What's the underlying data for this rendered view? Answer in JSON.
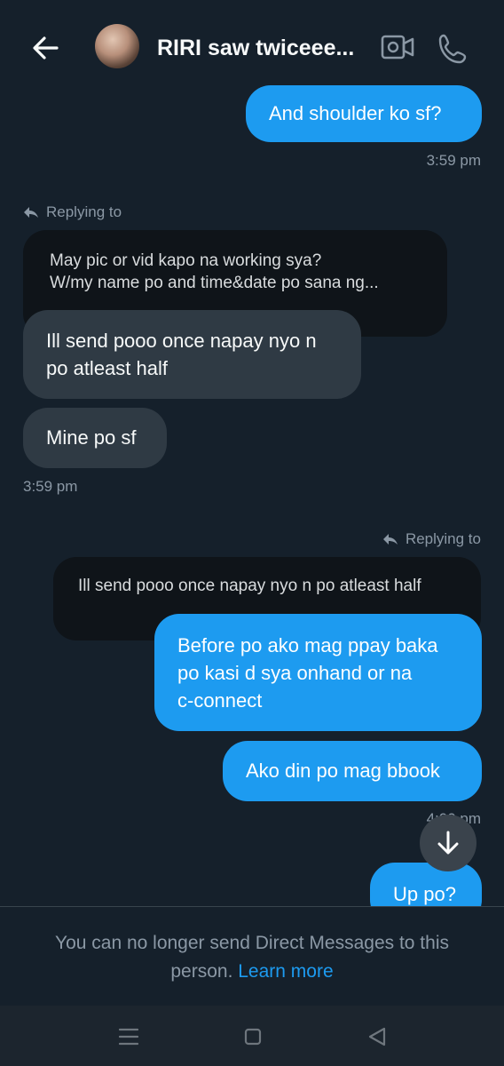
{
  "header": {
    "title": "RIRI saw twiceee...",
    "back_icon": "arrow-left-icon",
    "video_icon": "video-camera-icon",
    "phone_icon": "phone-icon"
  },
  "messages": [
    {
      "text": "And shoulder ko sf?",
      "time": "3:59 pm"
    },
    {
      "replying_label": "Replying to",
      "quote_line1": "May pic or vid kapo na working sya?",
      "quote_line2": "W/my name po and time&date po sana ng..."
    },
    {
      "line1": "Ill send pooo once napay nyo n",
      "line2": "po atleast half"
    },
    {
      "text": "Mine po sf",
      "time": "3:59 pm"
    },
    {
      "replying_label": "Replying to",
      "quote": "Ill send pooo once napay nyo n po atleast half"
    },
    {
      "line1": "Before po ako mag ppay baka",
      "line2": "po kasi d sya onhand or na",
      "line3": "c-connect"
    },
    {
      "text": "Ako din po mag bbook",
      "time": "4:00 pm"
    },
    {
      "text": "Up po?"
    }
  ],
  "footer": {
    "notice": "You can no longer send Direct Messages to this person.",
    "learn_more": "Learn more"
  },
  "colors": {
    "accent": "#1d9bf0",
    "background": "#15202b",
    "incoming": "#2f3a44"
  }
}
